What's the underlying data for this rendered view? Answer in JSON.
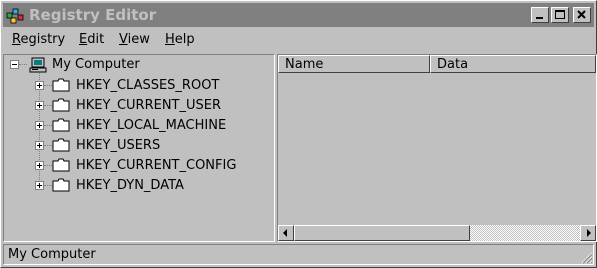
{
  "window": {
    "title": "Registry Editor",
    "icon": "registry-editor-icon",
    "buttons": [
      "minimize-icon",
      "maximize-icon",
      "close-icon"
    ]
  },
  "menubar": {
    "items": [
      {
        "label": "Registry",
        "underline": "R"
      },
      {
        "label": "Edit",
        "underline": "E"
      },
      {
        "label": "View",
        "underline": "V"
      },
      {
        "label": "Help",
        "underline": "H"
      }
    ]
  },
  "tree": {
    "root": {
      "label": "My Computer",
      "icon": "computer-icon",
      "expanded": true
    },
    "keys": [
      {
        "label": "HKEY_CLASSES_ROOT"
      },
      {
        "label": "HKEY_CURRENT_USER"
      },
      {
        "label": "HKEY_LOCAL_MACHINE"
      },
      {
        "label": "HKEY_USERS"
      },
      {
        "label": "HKEY_CURRENT_CONFIG"
      },
      {
        "label": "HKEY_DYN_DATA"
      }
    ]
  },
  "list": {
    "columns": [
      "Name",
      "Data"
    ]
  },
  "status": {
    "text": "My Computer"
  },
  "colors": {
    "face": "#c0c0c0",
    "titlebar_inactive": "#808080",
    "shadow": "#808080",
    "highlight": "#ffffff"
  }
}
